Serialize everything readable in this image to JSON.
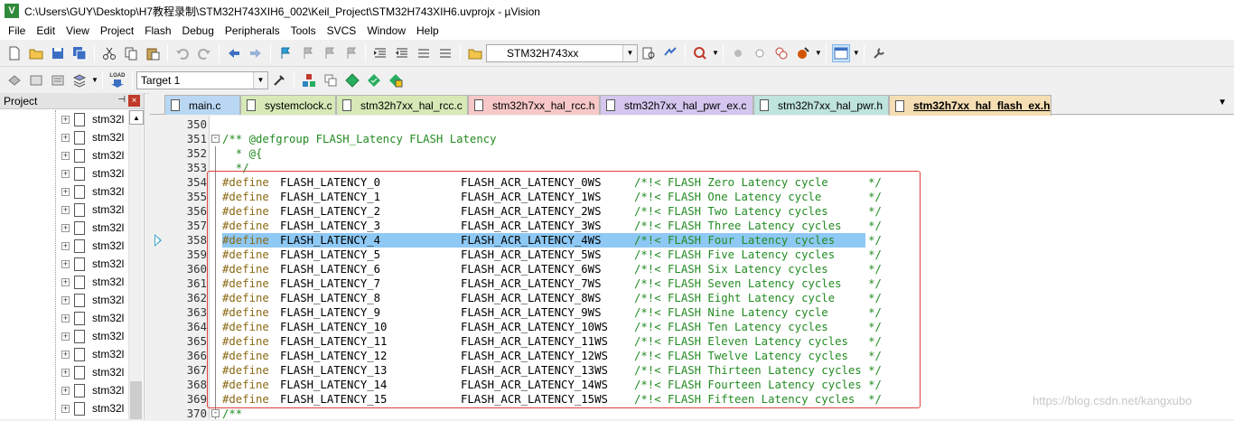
{
  "window": {
    "title": "C:\\Users\\GUY\\Desktop\\H7教程录制\\STM32H743XIH6_002\\Keil_Project\\STM32H743XIH6.uvprojx - µVision",
    "logo_text": "V"
  },
  "menu": [
    "File",
    "Edit",
    "View",
    "Project",
    "Flash",
    "Debug",
    "Peripherals",
    "Tools",
    "SVCS",
    "Window",
    "Help"
  ],
  "toolbar": {
    "device_select": "STM32H743xx",
    "target_select": "Target 1",
    "load_label": "LOAD"
  },
  "project_panel": {
    "title": "Project",
    "pin": "p",
    "close": "×",
    "files": [
      "stm32l",
      "stm32l",
      "stm32l",
      "stm32l",
      "stm32l",
      "stm32l",
      "stm32l",
      "stm32l",
      "stm32l",
      "stm32l",
      "stm32l",
      "stm32l",
      "stm32l",
      "stm32l",
      "stm32l",
      "stm32l",
      "stm32l"
    ]
  },
  "tabs": [
    {
      "label": "main.c",
      "color": "#b9d7f3"
    },
    {
      "label": "systemclock.c",
      "color": "#d6e9b6"
    },
    {
      "label": "stm32h7xx_hal_rcc.c",
      "color": "#d6e9b6"
    },
    {
      "label": "stm32h7xx_hal_rcc.h",
      "color": "#f8c8c8"
    },
    {
      "label": "stm32h7xx_hal_pwr_ex.c",
      "color": "#d4c6ee"
    },
    {
      "label": "stm32h7xx_hal_pwr.h",
      "color": "#bfe3dd"
    },
    {
      "label": "stm32h7xx_hal_flash_ex.h",
      "color": "#f5deb3"
    }
  ],
  "editor": {
    "current_line": "358",
    "lines": [
      {
        "n": "350",
        "fold": "",
        "kind": "plain",
        "text": ""
      },
      {
        "n": "351",
        "fold": "-",
        "kind": "comment",
        "text": "/** @defgroup FLASH_Latency FLASH Latency"
      },
      {
        "n": "352",
        "fold": "",
        "kind": "comment",
        "text": "  * @{"
      },
      {
        "n": "353",
        "fold": "",
        "kind": "comment",
        "text": "  */"
      },
      {
        "n": "354",
        "fold": "",
        "kind": "define",
        "name": "FLASH_LATENCY_0",
        "value": "FLASH_ACR_LATENCY_0WS",
        "comment": "/*!< FLASH Zero Latency cycle      */"
      },
      {
        "n": "355",
        "fold": "",
        "kind": "define",
        "name": "FLASH_LATENCY_1",
        "value": "FLASH_ACR_LATENCY_1WS",
        "comment": "/*!< FLASH One Latency cycle       */"
      },
      {
        "n": "356",
        "fold": "",
        "kind": "define",
        "name": "FLASH_LATENCY_2",
        "value": "FLASH_ACR_LATENCY_2WS",
        "comment": "/*!< FLASH Two Latency cycles      */"
      },
      {
        "n": "357",
        "fold": "",
        "kind": "define",
        "name": "FLASH_LATENCY_3",
        "value": "FLASH_ACR_LATENCY_3WS",
        "comment": "/*!< FLASH Three Latency cycles    */"
      },
      {
        "n": "358",
        "fold": "",
        "kind": "define",
        "name": "FLASH_LATENCY_4",
        "value": "FLASH_ACR_LATENCY_4WS",
        "comment": "/*!< FLASH Four Latency cycles     */"
      },
      {
        "n": "359",
        "fold": "",
        "kind": "define",
        "name": "FLASH_LATENCY_5",
        "value": "FLASH_ACR_LATENCY_5WS",
        "comment": "/*!< FLASH Five Latency cycles     */"
      },
      {
        "n": "360",
        "fold": "",
        "kind": "define",
        "name": "FLASH_LATENCY_6",
        "value": "FLASH_ACR_LATENCY_6WS",
        "comment": "/*!< FLASH Six Latency cycles      */"
      },
      {
        "n": "361",
        "fold": "",
        "kind": "define",
        "name": "FLASH_LATENCY_7",
        "value": "FLASH_ACR_LATENCY_7WS",
        "comment": "/*!< FLASH Seven Latency cycles    */"
      },
      {
        "n": "362",
        "fold": "",
        "kind": "define",
        "name": "FLASH_LATENCY_8",
        "value": "FLASH_ACR_LATENCY_8WS",
        "comment": "/*!< FLASH Eight Latency cycle     */"
      },
      {
        "n": "363",
        "fold": "",
        "kind": "define",
        "name": "FLASH_LATENCY_9",
        "value": "FLASH_ACR_LATENCY_9WS",
        "comment": "/*!< FLASH Nine Latency cycle      */"
      },
      {
        "n": "364",
        "fold": "",
        "kind": "define",
        "name": "FLASH_LATENCY_10",
        "value": "FLASH_ACR_LATENCY_10WS",
        "comment": "/*!< FLASH Ten Latency cycles      */"
      },
      {
        "n": "365",
        "fold": "",
        "kind": "define",
        "name": "FLASH_LATENCY_11",
        "value": "FLASH_ACR_LATENCY_11WS",
        "comment": "/*!< FLASH Eleven Latency cycles   */"
      },
      {
        "n": "366",
        "fold": "",
        "kind": "define",
        "name": "FLASH_LATENCY_12",
        "value": "FLASH_ACR_LATENCY_12WS",
        "comment": "/*!< FLASH Twelve Latency cycles   */"
      },
      {
        "n": "367",
        "fold": "",
        "kind": "define",
        "name": "FLASH_LATENCY_13",
        "value": "FLASH_ACR_LATENCY_13WS",
        "comment": "/*!< FLASH Thirteen Latency cycles */"
      },
      {
        "n": "368",
        "fold": "",
        "kind": "define",
        "name": "FLASH_LATENCY_14",
        "value": "FLASH_ACR_LATENCY_14WS",
        "comment": "/*!< FLASH Fourteen Latency cycles */"
      },
      {
        "n": "369",
        "fold": "",
        "kind": "define",
        "name": "FLASH_LATENCY_15",
        "value": "FLASH_ACR_LATENCY_15WS",
        "comment": "/*!< FLASH Fifteen Latency cycles  */"
      },
      {
        "n": "370",
        "fold": "-",
        "kind": "comment",
        "text": "/**"
      }
    ],
    "define_keyword": "#define"
  },
  "watermark": "https://blog.csdn.net/kangxubo",
  "colors": {
    "highlight": "#8ec8f4",
    "annotation_box": "#e04040",
    "comment": "#228b22",
    "preprocessor": "#8b6914"
  }
}
